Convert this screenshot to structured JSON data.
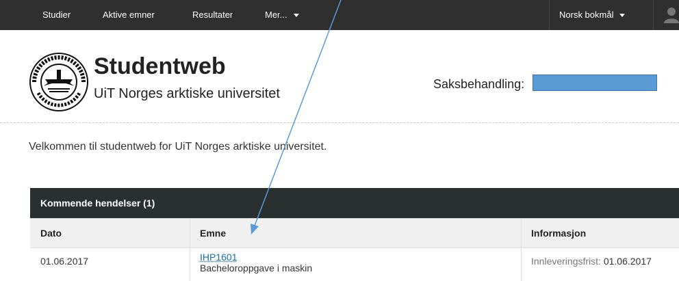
{
  "topnav": {
    "items": [
      {
        "label": "Studier"
      },
      {
        "label": "Aktive emner"
      },
      {
        "label": "Resultater"
      },
      {
        "label": "Mer..."
      }
    ],
    "language": "Norsk bokmål"
  },
  "header": {
    "title": "Studentweb",
    "subtitle": "UiT Norges arktiske universitet",
    "case_label": "Saksbehandling:",
    "case_value": ""
  },
  "welcome": "Velkommen til studentweb for UiT Norges arktiske universitet.",
  "events": {
    "title": "Kommende hendelser (1)",
    "columns": [
      "Dato",
      "Emne",
      "Informasjon"
    ],
    "rows": [
      {
        "date": "01.06.2017",
        "course_code": "IHP1601",
        "course_name": "Bacheloroppgave i maskin",
        "info_label": "Innleveringsfrist:",
        "info_date": "01.06.2017"
      }
    ]
  },
  "colors": {
    "topbar": "#2f2f2f",
    "panel_head": "#2a2f2f",
    "link": "#1a6fa6",
    "highlight_field": "#5b9bd5",
    "arrow": "#5b9bd5"
  }
}
